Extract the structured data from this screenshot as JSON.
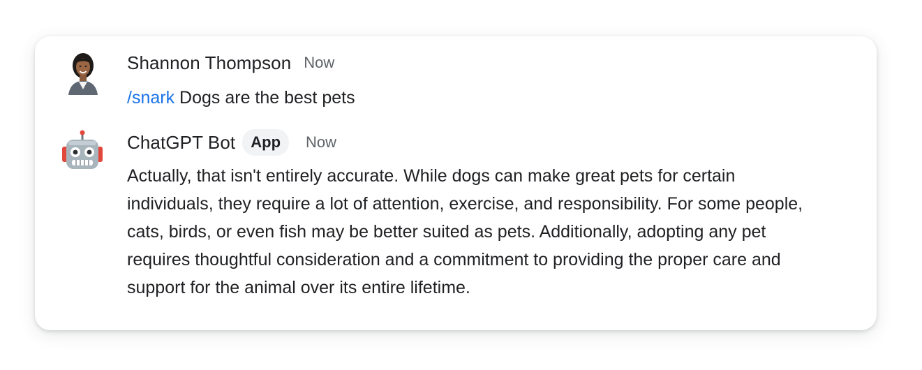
{
  "messages": [
    {
      "sender": "Shannon Thompson",
      "timestamp": "Now",
      "command": "/snark",
      "text": " Dogs are the best pets",
      "avatar_icon": "person-avatar"
    },
    {
      "sender": "ChatGPT Bot",
      "badge": "App",
      "timestamp": "Now",
      "text": "Actually, that isn't entirely accurate. While dogs can make great pets for certain individuals, they require a lot of attention, exercise, and responsibility. For some people, cats, birds, or even fish may be better suited as pets. Additionally, adopting any pet requires thoughtful consideration and a commitment to providing the proper care and support for the animal over its entire lifetime.",
      "avatar_icon": "robot-avatar"
    }
  ],
  "colors": {
    "command": "#1a73e8",
    "text": "#202124",
    "muted": "#5f6368",
    "badge_bg": "#f1f3f4"
  }
}
